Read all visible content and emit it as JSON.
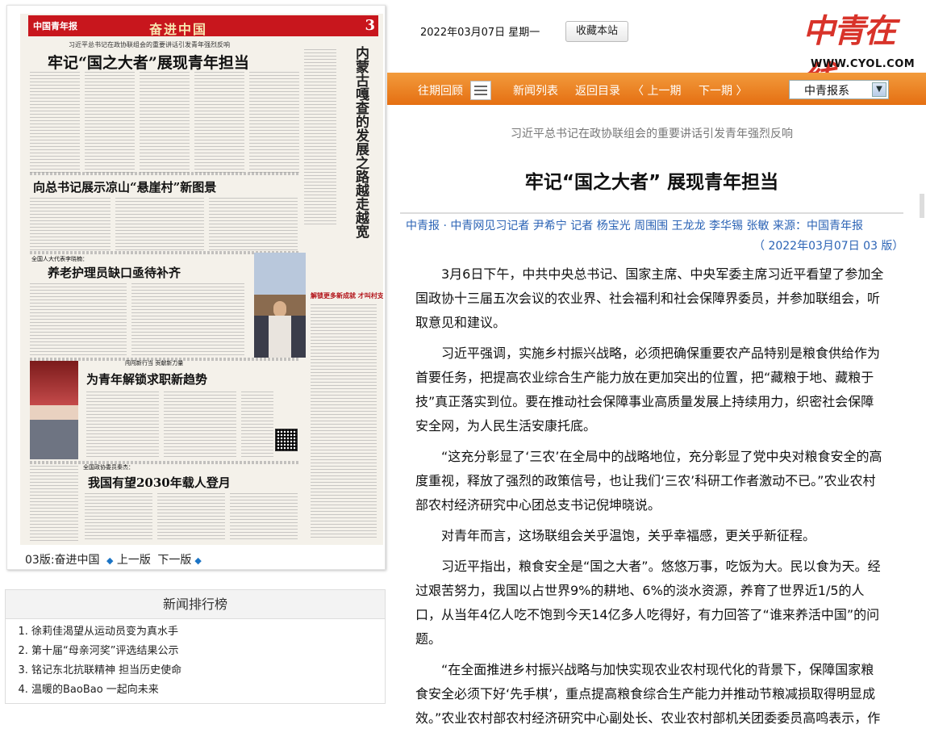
{
  "header": {
    "date": "2022年03月07日  星期一",
    "favorite_label": "收藏本站",
    "logo_text": "中青在线",
    "logo_url": "WWW.CYOL.COM"
  },
  "nav": {
    "items": [
      "往期回顾",
      "新闻列表",
      "返回目录",
      "〈  上一期",
      "下一期  〉"
    ],
    "select_value": "中青报系"
  },
  "newspaper": {
    "masthead": "中国青年报",
    "section": "奋进中国",
    "page_num": "3",
    "headlines": [
      "习近平总书记在政协联组会的重要讲话引发青年强烈反响",
      "牢记“国之大者”展现青年担当",
      "向总书记展示凉山“悬崖村”新图景",
      "全国人大代表李晓楠：",
      "养老护理员缺口亟待补齐",
      "闯闯新行当  贡献新力量",
      "为青年解锁求职新趋势",
      "全国政协委员秦杰：",
      "我国有望2030年载人登月",
      "内蒙古嘎查的发展之路越走越宽",
      "解锁更多新成就  才叫村支部书记"
    ],
    "pager": {
      "current": "03版:奋进中国",
      "prev": "上一版",
      "next": "下一版"
    }
  },
  "ranking": {
    "title": "新闻排行榜",
    "items": [
      "徐莉佳渴望从运动员变为真水手",
      "第十届“母亲河奖”评选结果公示",
      "铭记东北抗联精神 担当历史使命",
      "温暖的BaoBao 一起向未来"
    ]
  },
  "article": {
    "subhead": "习近平总书记在政协联组会的重要讲话引发青年强烈反响",
    "title": "牢记“国之大者” 展现青年担当",
    "byline": "中青报 · 中青网见习记者 尹希宁 记者 杨宝光 周围围 王龙龙 李华锡 张敏     来源：中国青年报",
    "dateline": "（  2022年03月07日     03  版）",
    "paragraphs": [
      "3月6日下午，中共中央总书记、国家主席、中央军委主席习近平看望了参加全国政协十三届五次会议的农业界、社会福利和社会保障界委员，并参加联组会，听取意见和建议。",
      "习近平强调，实施乡村振兴战略，必须把确保重要农产品特别是粮食供给作为首要任务，把提高农业综合生产能力放在更加突出的位置，把“藏粮于地、藏粮于技”真正落实到位。要在推动社会保障事业高质量发展上持续用力，织密社会保障安全网，为人民生活安康托底。",
      "“这充分彰显了‘三农’在全局中的战略地位，充分彰显了党中央对粮食安全的高度重视，释放了强烈的政策信号，也让我们‘三农’科研工作者激动不已。”农业农村部农村经济研究中心团总支书记倪坤晓说。",
      "对青年而言，这场联组会关乎温饱，关乎幸福感，更关乎新征程。",
      "习近平指出，粮食安全是“国之大者”。悠悠万事，吃饭为大。民以食为天。经过艰苦努力，我国以占世界9%的耕地、6%的淡水资源，养育了世界近1/5的人口，从当年4亿人吃不饱到今天14亿多人吃得好，有力回答了“谁来养活中国”的问题。",
      "“在全面推进乡村振兴战略与加快实现农业农村现代化的背景下，保障国家粮食安全必须下好‘先手棋’，重点提高粮食综合生产能力并推动节粮减损取得明显成效。”农业农村部农村经济研究中心副处长、农业农村部机关团委委员高鸣表示，作"
    ]
  }
}
